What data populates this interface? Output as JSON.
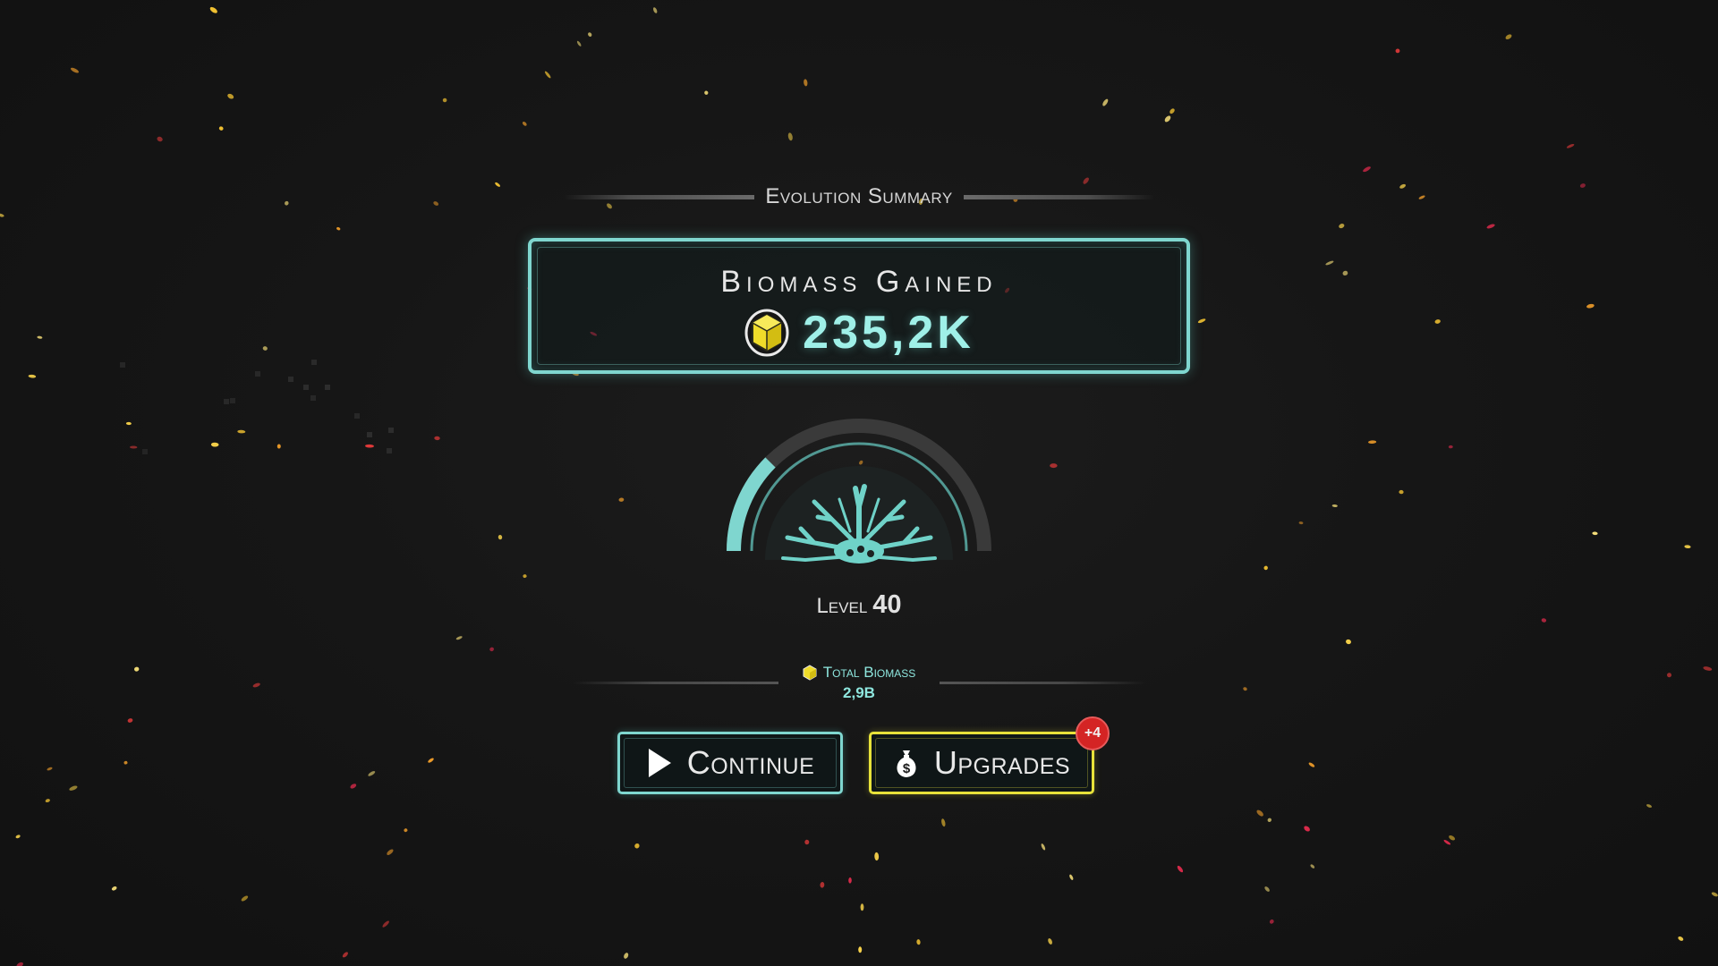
{
  "header": {
    "title": "Evolution Summary"
  },
  "biomass_gained": {
    "label": "Biomass Gained",
    "value": "235,2K",
    "icon": "biomass-crystal-icon"
  },
  "level": {
    "label": "Level",
    "value": "40",
    "progress_fraction": 0.25,
    "icon": "tendril-organism-icon"
  },
  "total_biomass": {
    "label": "Total Biomass",
    "value": "2,9B",
    "icon": "biomass-crystal-icon"
  },
  "buttons": {
    "continue": {
      "label": "Continue",
      "icon": "play-icon"
    },
    "upgrades": {
      "label": "Upgrades",
      "icon": "money-bag-icon",
      "badge": "+4"
    }
  },
  "colors": {
    "background": "#151515",
    "accent_teal": "#7fd6cf",
    "value_teal": "#9ff0e8",
    "accent_yellow": "#e8e23a",
    "badge_red": "#d42424",
    "crystal_yellow": "#f0dc2a"
  }
}
